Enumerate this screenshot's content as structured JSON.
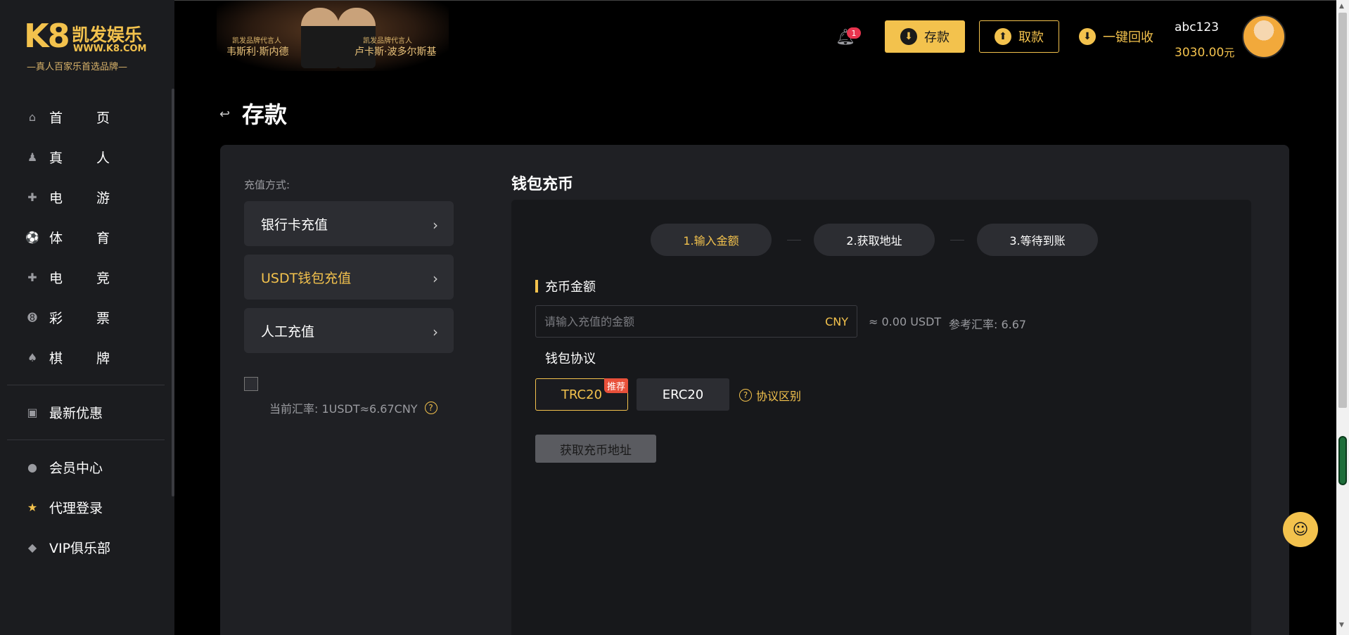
{
  "logo": {
    "mark": "K8",
    "brand": "凯发娱乐",
    "url": "WWW.K8.COM",
    "slogan": "—真人百家乐首选品牌—"
  },
  "sidebar": {
    "items": [
      {
        "icon": "home-icon",
        "c1": "首",
        "c2": "页"
      },
      {
        "icon": "live-dealer-icon",
        "c1": "真",
        "c2": "人"
      },
      {
        "icon": "gamepad-icon",
        "c1": "电",
        "c2": "游"
      },
      {
        "icon": "soccer-ball-icon",
        "c1": "体",
        "c2": "育"
      },
      {
        "icon": "esports-controller-icon",
        "c1": "电",
        "c2": "竞"
      },
      {
        "icon": "lottery-ball-icon",
        "c1": "彩",
        "c2": "票"
      },
      {
        "icon": "cards-icon",
        "c1": "棋",
        "c2": "牌"
      }
    ],
    "promo": {
      "icon": "gift-icon",
      "label": "最新优惠"
    },
    "links": [
      {
        "icon": "user-icon",
        "label": "会员中心"
      },
      {
        "icon": "star-icon",
        "label": "代理登录"
      },
      {
        "icon": "diamond-icon",
        "label": "VIP俱乐部"
      }
    ]
  },
  "banner": {
    "left_sub": "凯发品牌代言人",
    "left_name": "韦斯利·斯内德",
    "right_sub": "凯发品牌代言人",
    "right_name": "卢卡斯·波多尔斯基"
  },
  "header": {
    "notifications": "1",
    "deposit_label": "存款",
    "withdraw_label": "取款",
    "recycle_label": "一键回收",
    "username": "abc123",
    "balance": "3030.00",
    "balance_unit": "元"
  },
  "page": {
    "title": "存款"
  },
  "methods": {
    "label": "充值方式:",
    "items": [
      "银行卡充值",
      "USDT钱包充值",
      "人工充值"
    ],
    "active_index": 1,
    "current_rate": "当前汇率: 1USDT≈6.67CNY"
  },
  "wallet": {
    "title": "钱包充币",
    "steps": [
      "1.输入金额",
      "2.获取地址",
      "3.等待到账"
    ],
    "amount_title": "充币金额",
    "amount_placeholder": "请输入充值的金额",
    "currency": "CNY",
    "approx": "≈ 0.00 USDT",
    "ref_rate": "参考汇率: 6.67",
    "protocol_title": "钱包协议",
    "protocols": [
      "TRC20",
      "ERC20"
    ],
    "recommended_badge": "推荐",
    "protocol_diff": "协议区别",
    "get_address": "获取充币地址"
  },
  "colors": {
    "accent": "#f3c24d",
    "panel": "#1f2024",
    "card": "#17181b",
    "badge": "#e8344e"
  }
}
